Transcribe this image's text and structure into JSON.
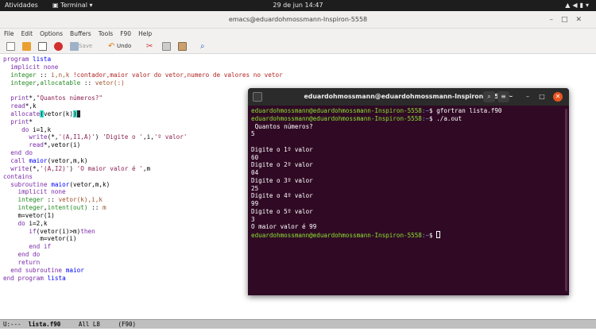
{
  "topbar": {
    "activities": "Atividades",
    "app": "Terminal",
    "clock": "29 de jun  14:47"
  },
  "emacs": {
    "title": "emacs@eduardohmossmann-Inspiron-5558",
    "menu": [
      "File",
      "Edit",
      "Options",
      "Buffers",
      "Tools",
      "F90",
      "Help"
    ],
    "toolbar": {
      "save": "Save",
      "undo": "Undo"
    },
    "code_lines": [
      "program lista",
      "  implicit none",
      "  integer :: i,n,k !contador,maior valor do vetor,numero de valores no vetor",
      "  integer,allocatable :: vetor(:)",
      "",
      "  print*,\"Quantos números?\"",
      "  read*,k",
      "  allocate(vetor(k))",
      "  print*",
      "     do i=1,k",
      "       write(*,'(A,I1,A)') 'Digite o ',i,'º valor'",
      "       read*,vetor(i)",
      "  end do",
      "  call maior(vetor,m,k)",
      "  write(*,'(A,I2)') 'O maior valor é ',m",
      "contains",
      "  subroutine maior(vetor,m,k)",
      "    implicit none",
      "    integer :: vetor(k),i,k",
      "    integer,intent(out) :: m",
      "    m=vetor(1)",
      "    do i=2,k",
      "       if(vetor(i)>m)then",
      "          m=vetor(i)",
      "       end if",
      "    end do",
      "    return",
      "  end subroutine maior",
      "end program lista"
    ],
    "modeline": {
      "status": "U:---",
      "buffer": "lista.f90",
      "position": "All L8",
      "mode": "(F90)"
    }
  },
  "terminal": {
    "title": "eduardohmossmann@eduardohmossmann-Inspiron-5558: ~",
    "prompt_user": "eduardohmossmann@eduardohmossmann-Inspiron-5558",
    "prompt_path": ":~",
    "prompt_symbol": "$",
    "cmd1": " gfortran lista.f90",
    "cmd2": " ./a.out",
    "output": [
      " Quantos números?",
      "5",
      "",
      "Digite o 1º valor",
      "60",
      "Digite o 2º valor",
      "04",
      "Digite o 3º valor",
      "25",
      "Digite o 4º valor",
      "99",
      "Digite o 5º valor",
      "3",
      "O maior valor é 99"
    ]
  },
  "colors": {
    "terminal_bg": "#300a24",
    "prompt_user": "#8ae234",
    "prompt_path": "#729fcf",
    "keyword": "#7a2aa8",
    "type": "#228b22",
    "comment": "#b22222",
    "string": "#8b2252",
    "function": "#0000ff"
  }
}
